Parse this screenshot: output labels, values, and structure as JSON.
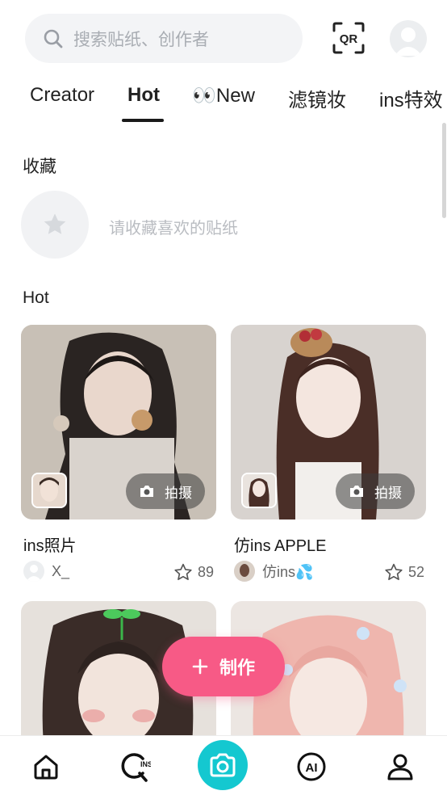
{
  "search": {
    "placeholder": "搜索贴纸、创作者",
    "icon": "search-icon"
  },
  "header": {
    "qr_label": "QR",
    "avatar": "user-avatar"
  },
  "tabs": [
    {
      "label": "Creator",
      "active": false
    },
    {
      "label": "Hot",
      "active": true
    },
    {
      "label": "👀New",
      "active": false
    },
    {
      "label": "滤镜妆",
      "active": false
    },
    {
      "label": "ins特效",
      "active": false
    }
  ],
  "favorites": {
    "title": "收藏",
    "empty_text": "请收藏喜欢的贴纸",
    "icon": "star-icon"
  },
  "hot": {
    "title": "Hot",
    "cards": [
      {
        "title": "ins照片",
        "author": "X_",
        "likes": "89",
        "shoot_label": "拍摄"
      },
      {
        "title": "仿ins APPLE",
        "author": "仿ins💦",
        "likes": "52",
        "shoot_label": "拍摄"
      },
      {
        "title": "",
        "author": "",
        "likes": "",
        "shoot_label": ""
      },
      {
        "title": "",
        "author": "",
        "likes": "",
        "shoot_label": ""
      }
    ]
  },
  "make_button": {
    "label": "制作",
    "icon": "plus-icon"
  },
  "bottom_nav": [
    {
      "name": "home-icon"
    },
    {
      "name": "ins-search-icon"
    },
    {
      "name": "camera-icon"
    },
    {
      "name": "ai-icon"
    },
    {
      "name": "profile-icon"
    }
  ],
  "colors": {
    "accent_pink": "#f75a86",
    "camera_teal": "#14c8d0"
  }
}
